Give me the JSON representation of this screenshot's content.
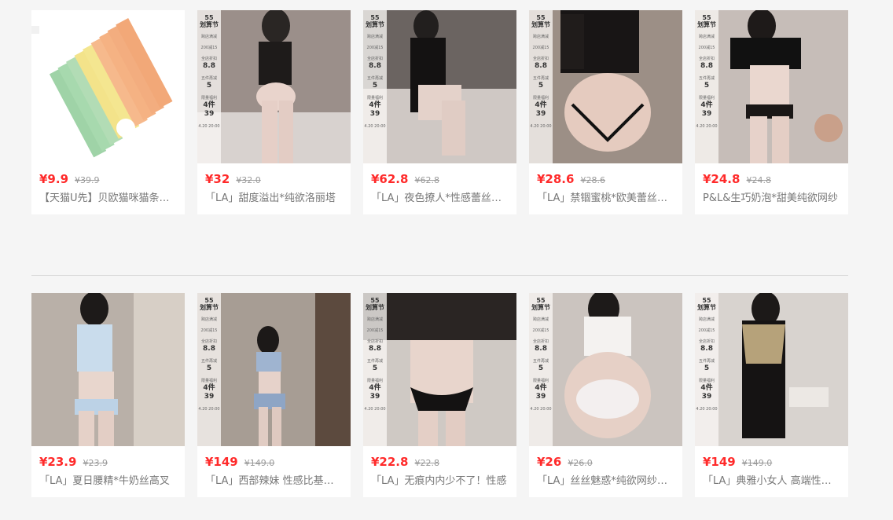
{
  "strip": {
    "logo_top": "55",
    "logo_bottom": "划算节",
    "line1": "跨店满减",
    "line1b": "200减15",
    "line2": "全店折扣",
    "line2b": "8.8",
    "line3": "五件再减",
    "line3b": "5",
    "line4": "限量福利",
    "line4b": "4件",
    "line5": "39",
    "date": "4.20 20:00"
  },
  "products": [
    {
      "price": "¥9.9",
      "orig": "¥39.9",
      "title": "【天猫U先】贝欧猫咪猫条零食"
    },
    {
      "price": "¥32",
      "orig": "¥32.0",
      "title": "「LA」甜度溢出*纯欲洛丽塔"
    },
    {
      "price": "¥62.8",
      "orig": "¥62.8",
      "title": "「LA」夜色撩人*性感蕾丝睡裙"
    },
    {
      "price": "¥28.6",
      "orig": "¥28.6",
      "title": "「LA」禁锢蜜桃*欧美蕾丝内裤"
    },
    {
      "price": "¥24.8",
      "orig": "¥24.8",
      "title": "P&L&生巧奶泡*甜美纯欲网纱"
    },
    {
      "price": "¥23.9",
      "orig": "¥23.9",
      "title": "「LA」夏日腰精*牛奶丝高叉"
    },
    {
      "price": "¥149",
      "orig": "¥149.0",
      "title": "「LA」西部辣妹 性感比基尼套装"
    },
    {
      "price": "¥22.8",
      "orig": "¥22.8",
      "title": "「LA」无痕内内少不了！性感"
    },
    {
      "price": "¥26",
      "orig": "¥26.0",
      "title": "「LA」丝丝魅惑*纯欲网纱内裤"
    },
    {
      "price": "¥149",
      "orig": "¥149.0",
      "title": "「LA」典雅小女人 高端性感睡裙"
    }
  ]
}
